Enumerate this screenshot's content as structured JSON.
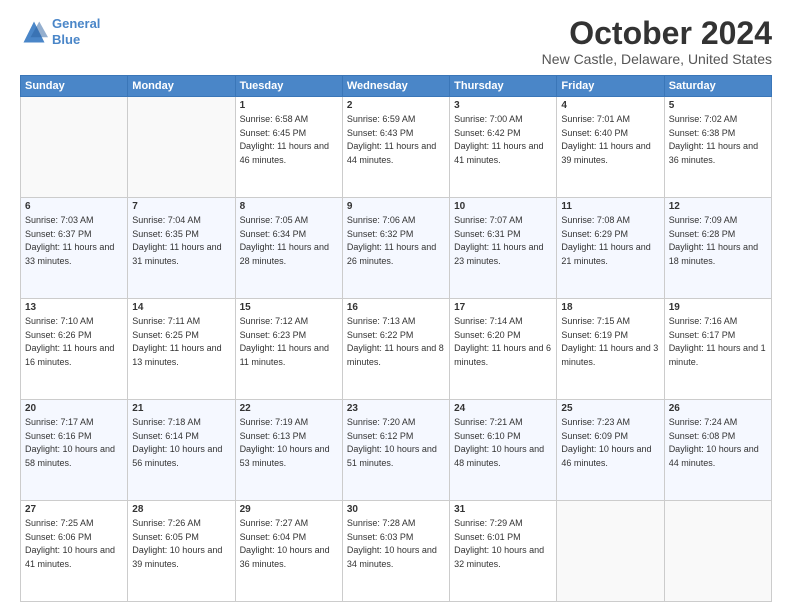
{
  "header": {
    "logo_line1": "General",
    "logo_line2": "Blue",
    "title": "October 2024",
    "subtitle": "New Castle, Delaware, United States"
  },
  "days_of_week": [
    "Sunday",
    "Monday",
    "Tuesday",
    "Wednesday",
    "Thursday",
    "Friday",
    "Saturday"
  ],
  "weeks": [
    [
      {
        "day": "",
        "info": ""
      },
      {
        "day": "",
        "info": ""
      },
      {
        "day": "1",
        "info": "Sunrise: 6:58 AM\nSunset: 6:45 PM\nDaylight: 11 hours and 46 minutes."
      },
      {
        "day": "2",
        "info": "Sunrise: 6:59 AM\nSunset: 6:43 PM\nDaylight: 11 hours and 44 minutes."
      },
      {
        "day": "3",
        "info": "Sunrise: 7:00 AM\nSunset: 6:42 PM\nDaylight: 11 hours and 41 minutes."
      },
      {
        "day": "4",
        "info": "Sunrise: 7:01 AM\nSunset: 6:40 PM\nDaylight: 11 hours and 39 minutes."
      },
      {
        "day": "5",
        "info": "Sunrise: 7:02 AM\nSunset: 6:38 PM\nDaylight: 11 hours and 36 minutes."
      }
    ],
    [
      {
        "day": "6",
        "info": "Sunrise: 7:03 AM\nSunset: 6:37 PM\nDaylight: 11 hours and 33 minutes."
      },
      {
        "day": "7",
        "info": "Sunrise: 7:04 AM\nSunset: 6:35 PM\nDaylight: 11 hours and 31 minutes."
      },
      {
        "day": "8",
        "info": "Sunrise: 7:05 AM\nSunset: 6:34 PM\nDaylight: 11 hours and 28 minutes."
      },
      {
        "day": "9",
        "info": "Sunrise: 7:06 AM\nSunset: 6:32 PM\nDaylight: 11 hours and 26 minutes."
      },
      {
        "day": "10",
        "info": "Sunrise: 7:07 AM\nSunset: 6:31 PM\nDaylight: 11 hours and 23 minutes."
      },
      {
        "day": "11",
        "info": "Sunrise: 7:08 AM\nSunset: 6:29 PM\nDaylight: 11 hours and 21 minutes."
      },
      {
        "day": "12",
        "info": "Sunrise: 7:09 AM\nSunset: 6:28 PM\nDaylight: 11 hours and 18 minutes."
      }
    ],
    [
      {
        "day": "13",
        "info": "Sunrise: 7:10 AM\nSunset: 6:26 PM\nDaylight: 11 hours and 16 minutes."
      },
      {
        "day": "14",
        "info": "Sunrise: 7:11 AM\nSunset: 6:25 PM\nDaylight: 11 hours and 13 minutes."
      },
      {
        "day": "15",
        "info": "Sunrise: 7:12 AM\nSunset: 6:23 PM\nDaylight: 11 hours and 11 minutes."
      },
      {
        "day": "16",
        "info": "Sunrise: 7:13 AM\nSunset: 6:22 PM\nDaylight: 11 hours and 8 minutes."
      },
      {
        "day": "17",
        "info": "Sunrise: 7:14 AM\nSunset: 6:20 PM\nDaylight: 11 hours and 6 minutes."
      },
      {
        "day": "18",
        "info": "Sunrise: 7:15 AM\nSunset: 6:19 PM\nDaylight: 11 hours and 3 minutes."
      },
      {
        "day": "19",
        "info": "Sunrise: 7:16 AM\nSunset: 6:17 PM\nDaylight: 11 hours and 1 minute."
      }
    ],
    [
      {
        "day": "20",
        "info": "Sunrise: 7:17 AM\nSunset: 6:16 PM\nDaylight: 10 hours and 58 minutes."
      },
      {
        "day": "21",
        "info": "Sunrise: 7:18 AM\nSunset: 6:14 PM\nDaylight: 10 hours and 56 minutes."
      },
      {
        "day": "22",
        "info": "Sunrise: 7:19 AM\nSunset: 6:13 PM\nDaylight: 10 hours and 53 minutes."
      },
      {
        "day": "23",
        "info": "Sunrise: 7:20 AM\nSunset: 6:12 PM\nDaylight: 10 hours and 51 minutes."
      },
      {
        "day": "24",
        "info": "Sunrise: 7:21 AM\nSunset: 6:10 PM\nDaylight: 10 hours and 48 minutes."
      },
      {
        "day": "25",
        "info": "Sunrise: 7:23 AM\nSunset: 6:09 PM\nDaylight: 10 hours and 46 minutes."
      },
      {
        "day": "26",
        "info": "Sunrise: 7:24 AM\nSunset: 6:08 PM\nDaylight: 10 hours and 44 minutes."
      }
    ],
    [
      {
        "day": "27",
        "info": "Sunrise: 7:25 AM\nSunset: 6:06 PM\nDaylight: 10 hours and 41 minutes."
      },
      {
        "day": "28",
        "info": "Sunrise: 7:26 AM\nSunset: 6:05 PM\nDaylight: 10 hours and 39 minutes."
      },
      {
        "day": "29",
        "info": "Sunrise: 7:27 AM\nSunset: 6:04 PM\nDaylight: 10 hours and 36 minutes."
      },
      {
        "day": "30",
        "info": "Sunrise: 7:28 AM\nSunset: 6:03 PM\nDaylight: 10 hours and 34 minutes."
      },
      {
        "day": "31",
        "info": "Sunrise: 7:29 AM\nSunset: 6:01 PM\nDaylight: 10 hours and 32 minutes."
      },
      {
        "day": "",
        "info": ""
      },
      {
        "day": "",
        "info": ""
      }
    ]
  ]
}
